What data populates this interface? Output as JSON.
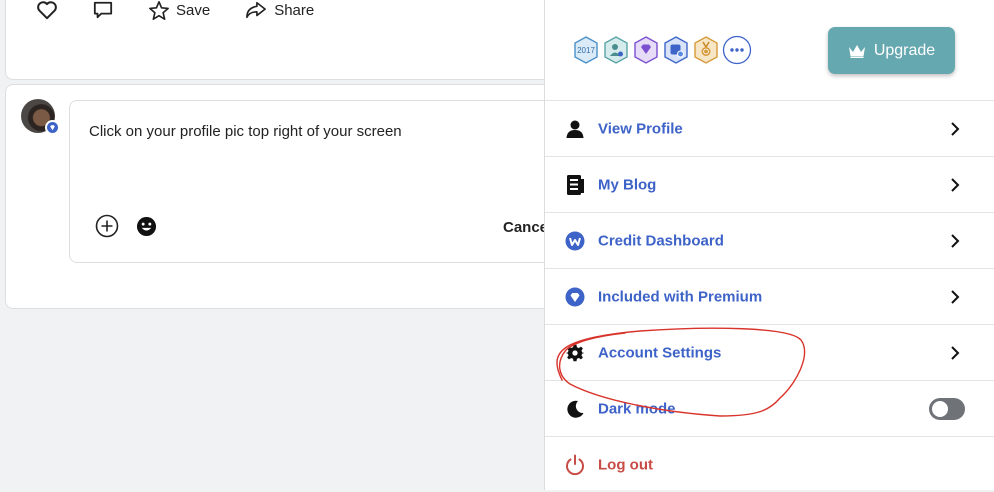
{
  "post_actions": {
    "like_icon": "heart-icon",
    "comment_icon": "comment-icon",
    "save_label": "Save",
    "share_label": "Share"
  },
  "comment_editor": {
    "text": "Click on your profile pic top right of your screen",
    "cancel_label": "Cance"
  },
  "profile_menu": {
    "badges": [
      {
        "name": "2017",
        "color": "#4a90c8"
      },
      {
        "name": "member-badge",
        "color": "#5aa4a6"
      },
      {
        "name": "premium-diamond-badge",
        "color": "#7b4fd0"
      },
      {
        "name": "verified-badge",
        "color": "#3d64c9"
      },
      {
        "name": "medal-badge",
        "color": "#d79a3a"
      }
    ],
    "upgrade_label": "Upgrade",
    "items": [
      {
        "label": "View Profile",
        "icon": "user-icon"
      },
      {
        "label": "My Blog",
        "icon": "blog-icon"
      },
      {
        "label": "Credit Dashboard",
        "icon": "credit-icon"
      },
      {
        "label": "Included with Premium",
        "icon": "diamond-icon"
      },
      {
        "label": "Account Settings",
        "icon": "gear-icon"
      },
      {
        "label": "Dark mode",
        "icon": "moon-icon",
        "toggle": "off"
      },
      {
        "label": "Log out",
        "icon": "power-icon"
      }
    ]
  },
  "colors": {
    "link_blue": "#3e63c8",
    "upgrade_bg": "#66a8b0",
    "logout_red": "#c84c46",
    "annotation_red": "#d9342b"
  }
}
